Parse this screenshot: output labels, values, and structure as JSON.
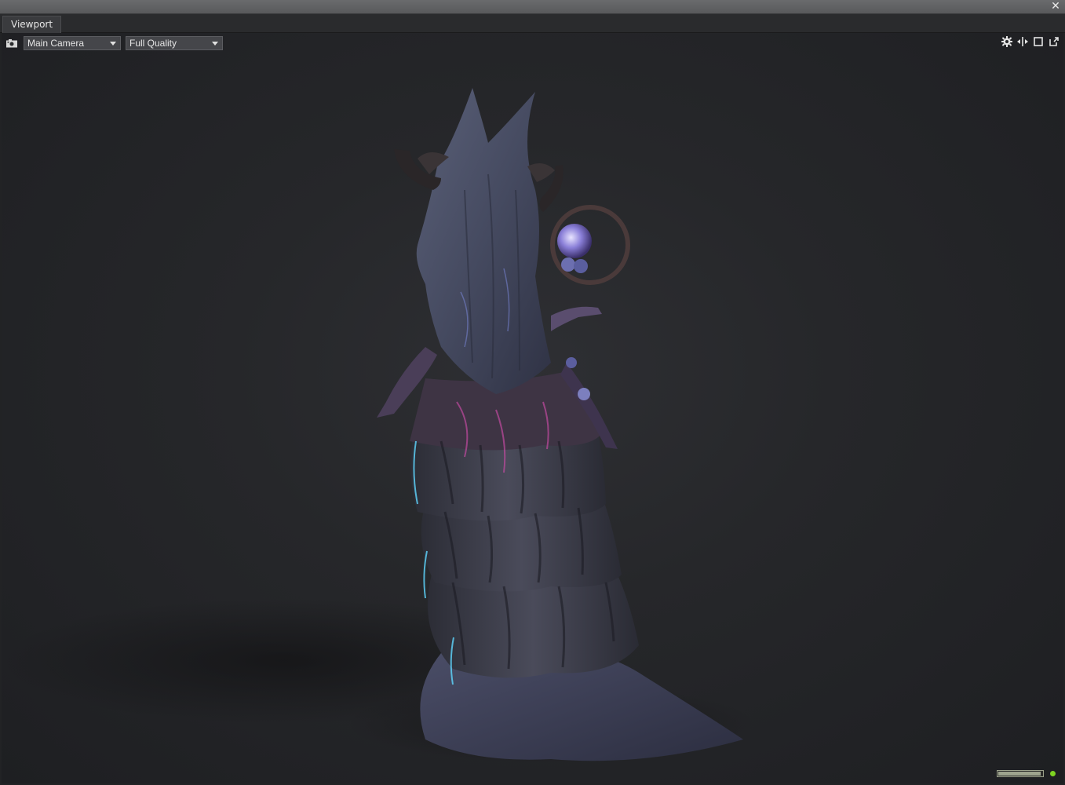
{
  "window": {
    "close_glyph": "✕",
    "tab_label": "Viewport"
  },
  "toolbar": {
    "camera_icon": "camera-icon",
    "camera_select": "Main Camera",
    "quality_select": "Full Quality"
  },
  "right_tools": [
    "gear-icon",
    "split-icon",
    "maximize-icon",
    "popout-icon"
  ],
  "status": {
    "progress": 0.97,
    "indicator_color": "#7ed321"
  },
  "colors": {
    "viewport_bg": "#26272a",
    "accent_cyan": "#5fd7ff",
    "accent_magenta": "#c04aa0"
  }
}
